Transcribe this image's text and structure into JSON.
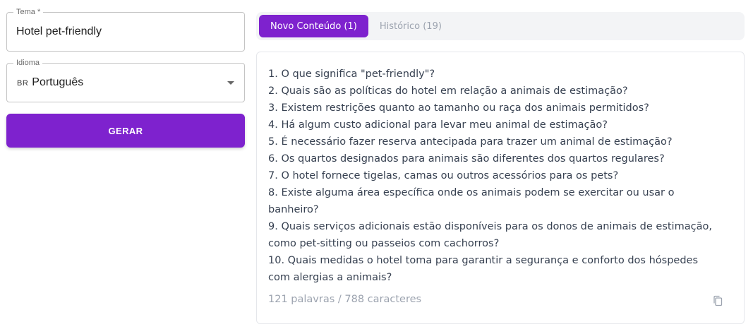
{
  "form": {
    "tema": {
      "label": "Tema *",
      "value": "Hotel pet-friendly"
    },
    "idioma": {
      "label": "Idioma",
      "flag": "BR",
      "value": "Português"
    },
    "generate_label": "GERAR"
  },
  "tabs": [
    {
      "label": "Novo Conteúdo (1)",
      "active": true
    },
    {
      "label": "Histórico (19)",
      "active": false
    }
  ],
  "result": {
    "text": "1. O que significa \"pet-friendly\"?\n2. Quais são as políticas do hotel em relação a animais de estimação?\n3. Existem restrições quanto ao tamanho ou raça dos animais permitidos?\n4. Há algum custo adicional para levar meu animal de estimação?\n5. É necessário fazer reserva antecipada para trazer um animal de estimação?\n6. Os quartos designados para animais são diferentes dos quartos regulares?\n7. O hotel fornece tigelas, camas ou outros acessórios para os pets?\n8. Existe alguma área específica onde os animais podem se exercitar ou usar o banheiro?\n9. Quais serviços adicionais estão disponíveis para os donos de animais de estimação, como pet-sitting ou passeios com cachorros?\n10. Quais medidas o hotel toma para garantir a segurança e conforto dos hóspedes com alergias a animais?",
    "count": "121 palavras / 788 caracteres",
    "copy_icon": "copy-icon"
  },
  "colors": {
    "accent": "#7e22ce",
    "tab_bar_bg": "#f3f4f6",
    "muted_text": "#9ca3af"
  }
}
